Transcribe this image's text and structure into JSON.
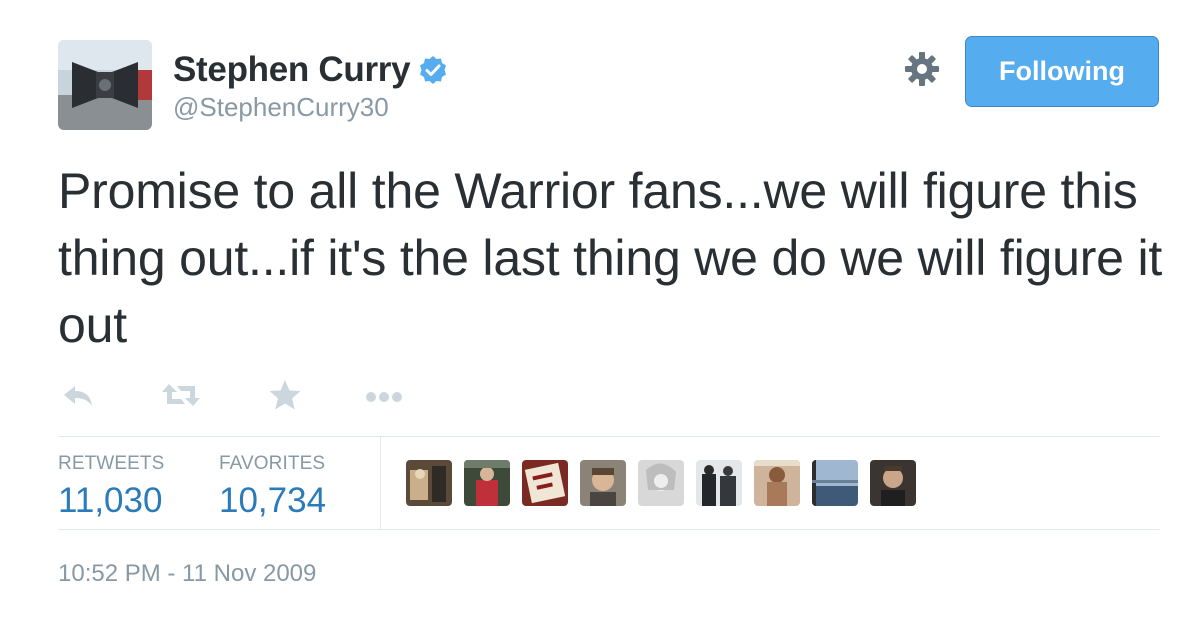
{
  "author": {
    "name": "Stephen Curry",
    "handle": "@StephenCurry30",
    "verified": true
  },
  "follow_button": {
    "label": "Following"
  },
  "tweet": {
    "text": "Promise to all the Warrior fans...we will figure this thing out...if it's the last thing we do we will figure it out"
  },
  "actions": [
    {
      "icon": "reply-icon"
    },
    {
      "icon": "retweet-icon"
    },
    {
      "icon": "favorite-star-icon"
    },
    {
      "icon": "more-dots-icon"
    }
  ],
  "stats": {
    "retweets_label": "RETWEETS",
    "retweets_value": "11,030",
    "favorites_label": "FAVORITES",
    "favorites_value": "10,734"
  },
  "favoriters_count_shown": 9,
  "timestamp": "10:52 PM - 11 Nov 2009",
  "colors": {
    "accent": "#55acee",
    "stat_value": "#2b7bb9",
    "muted": "#8899a6",
    "text": "#292f33"
  }
}
